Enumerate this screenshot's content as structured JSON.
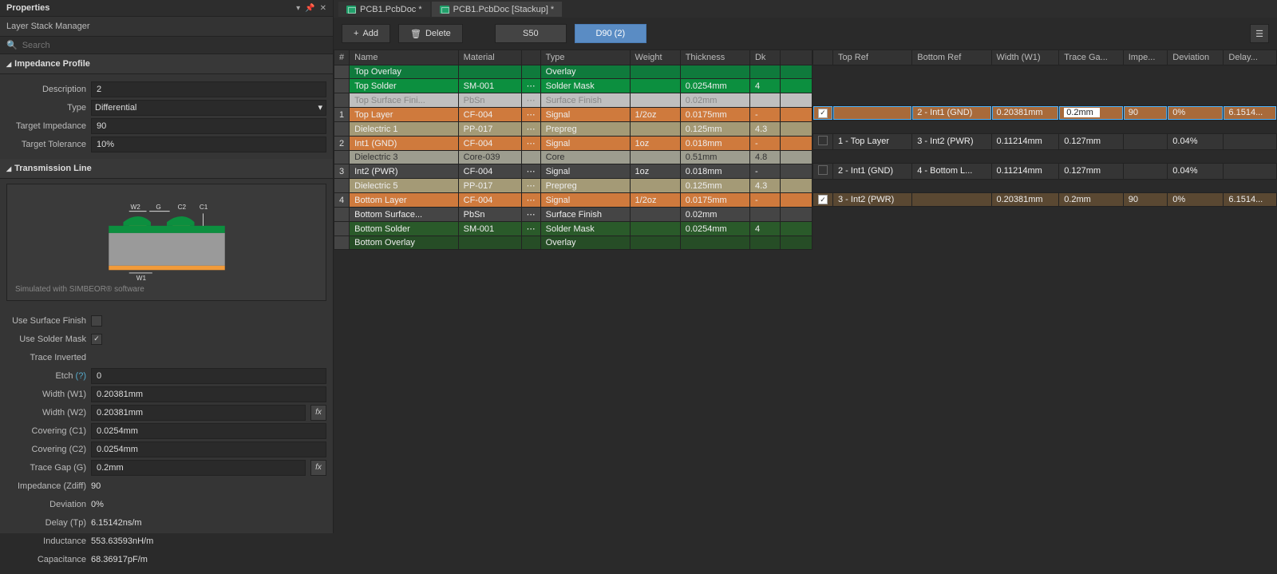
{
  "panel": {
    "title": "Properties",
    "subtitle": "Layer Stack Manager",
    "search_placeholder": "Search"
  },
  "impedance_profile": {
    "header": "Impedance Profile",
    "description_lbl": "Description",
    "description": "2",
    "type_lbl": "Type",
    "type": "Differential",
    "target_imp_lbl": "Target Impedance",
    "target_imp": "90",
    "target_tol_lbl": "Target Tolerance",
    "target_tol": "10%"
  },
  "transmission": {
    "header": "Transmission Line",
    "sim_note": "Simulated with SIMBEOR® software",
    "diag": {
      "W2": "W2",
      "G": "G",
      "C2": "C2",
      "C1": "C1",
      "W1": "W1"
    },
    "use_surface_lbl": "Use Surface Finish",
    "use_surface": false,
    "use_solder_lbl": "Use Solder Mask",
    "use_solder": true,
    "trace_inv_lbl": "Trace Inverted",
    "etch_lbl": "Etch",
    "etch_help": "(?)",
    "etch": "0",
    "w1_lbl": "Width (W1)",
    "w1": "0.20381mm",
    "w2_lbl": "Width (W2)",
    "w2": "0.20381mm",
    "c1_lbl": "Covering (C1)",
    "c1": "0.0254mm",
    "c2_lbl": "Covering (C2)",
    "c2": "0.0254mm",
    "gap_lbl": "Trace Gap (G)",
    "gap": "0.2mm",
    "zdiff_lbl": "Impedance (Zdiff)",
    "zdiff": "90",
    "dev_lbl": "Deviation",
    "dev": "0%",
    "tp_lbl": "Delay (Tp)",
    "tp": "6.15142ns/m",
    "ind_lbl": "Inductance",
    "ind": "553.63593nH/m",
    "cap_lbl": "Capacitance",
    "cap": "68.36917pF/m"
  },
  "tabs": {
    "t1": "PCB1.PcbDoc *",
    "t2": "PCB1.PcbDoc [Stackup] *"
  },
  "toolbar": {
    "add": "Add",
    "delete": "Delete",
    "s50": "S50",
    "d90": "D90 (2)"
  },
  "stack_headers": {
    "num": "#",
    "name": "Name",
    "material": "Material",
    "type": "Type",
    "weight": "Weight",
    "thickness": "Thickness",
    "dk": "Dk"
  },
  "stack_rows": [
    {
      "cls": "r-greenD",
      "num": "",
      "name": "Top Overlay",
      "mat": "",
      "lock": "",
      "type": "Overlay",
      "w": "",
      "th": "",
      "dk": ""
    },
    {
      "cls": "r-green",
      "num": "",
      "name": "Top Solder",
      "mat": "SM-001",
      "lock": "⋯",
      "type": "Solder Mask",
      "w": "",
      "th": "0.0254mm",
      "dk": "4"
    },
    {
      "cls": "r-grey",
      "num": "",
      "name": "Top Surface Fini...",
      "mat": "PbSn",
      "lock": "⋯",
      "type": "Surface Finish",
      "w": "",
      "th": "0.02mm",
      "dk": ""
    },
    {
      "cls": "r-copper",
      "num": "1",
      "name": "Top Layer",
      "mat": "CF-004",
      "lock": "⋯",
      "type": "Signal",
      "w": "1/2oz",
      "th": "0.0175mm",
      "dk": "-"
    },
    {
      "cls": "r-prepreg",
      "num": "",
      "name": "Dielectric 1",
      "mat": "PP-017",
      "lock": "⋯",
      "type": "Prepreg",
      "w": "",
      "th": "0.125mm",
      "dk": "4.3"
    },
    {
      "cls": "r-copper",
      "num": "2",
      "name": "Int1 (GND)",
      "mat": "CF-004",
      "lock": "⋯",
      "type": "Signal",
      "w": "1oz",
      "th": "0.018mm",
      "dk": "-"
    },
    {
      "cls": "r-core",
      "num": "",
      "name": "Dielectric 3",
      "mat": "Core-039",
      "lock": "",
      "type": "Core",
      "w": "",
      "th": "0.51mm",
      "dk": "4.8"
    },
    {
      "cls": "r-sig",
      "num": "3",
      "name": "Int2 (PWR)",
      "mat": "CF-004",
      "lock": "⋯",
      "type": "Signal",
      "w": "1oz",
      "th": "0.018mm",
      "dk": "-"
    },
    {
      "cls": "r-prepreg",
      "num": "",
      "name": "Dielectric 5",
      "mat": "PP-017",
      "lock": "⋯",
      "type": "Prepreg",
      "w": "",
      "th": "0.125mm",
      "dk": "4.3"
    },
    {
      "cls": "r-bcopper",
      "num": "4",
      "name": "Bottom Layer",
      "mat": "CF-004",
      "lock": "⋯",
      "type": "Signal",
      "w": "1/2oz",
      "th": "0.0175mm",
      "dk": "-"
    },
    {
      "cls": "r-sig",
      "num": "",
      "name": "Bottom Surface...",
      "mat": "PbSn",
      "lock": "⋯",
      "type": "Surface Finish",
      "w": "",
      "th": "0.02mm",
      "dk": ""
    },
    {
      "cls": "r-dgreen",
      "num": "",
      "name": "Bottom Solder",
      "mat": "SM-001",
      "lock": "⋯",
      "type": "Solder Mask",
      "w": "",
      "th": "0.0254mm",
      "dk": "4"
    },
    {
      "cls": "r-dgreen2",
      "num": "",
      "name": "Bottom Overlay",
      "mat": "",
      "lock": "",
      "type": "Overlay",
      "w": "",
      "th": "",
      "dk": ""
    }
  ],
  "imp_headers": {
    "chk": "",
    "top": "Top Ref",
    "bot": "Bottom Ref",
    "w1": "Width (W1)",
    "gap": "Trace Ga...",
    "imp": "Impe...",
    "dev": "Deviation",
    "delay": "Delay..."
  },
  "imp_rows": [
    {
      "cls": "rr-copper sel-outline",
      "chk": true,
      "top": "",
      "bot": "2 - Int1 (GND)",
      "w1": "0.20381mm",
      "gap": "0.2mm",
      "gap_edit": true,
      "imp": "90",
      "dev": "0%",
      "delay": "6.1514..."
    },
    {
      "cls": "rr-off",
      "chk": false,
      "top": "1 - Top Layer",
      "bot": "3 - Int2 (PWR)",
      "w1": "0.11214mm",
      "gap": "0.127mm",
      "imp": "",
      "dev": "0.04%",
      "delay": ""
    },
    {
      "cls": "rr-off",
      "chk": false,
      "top": "2 - Int1 (GND)",
      "bot": "4 - Bottom L...",
      "w1": "0.11214mm",
      "gap": "0.127mm",
      "imp": "",
      "dev": "0.04%",
      "delay": ""
    },
    {
      "cls": "rr-dark",
      "chk": true,
      "top": "3 - Int2 (PWR)",
      "bot": "",
      "w1": "0.20381mm",
      "gap": "0.2mm",
      "imp": "90",
      "dev": "0%",
      "delay": "6.1514..."
    }
  ]
}
